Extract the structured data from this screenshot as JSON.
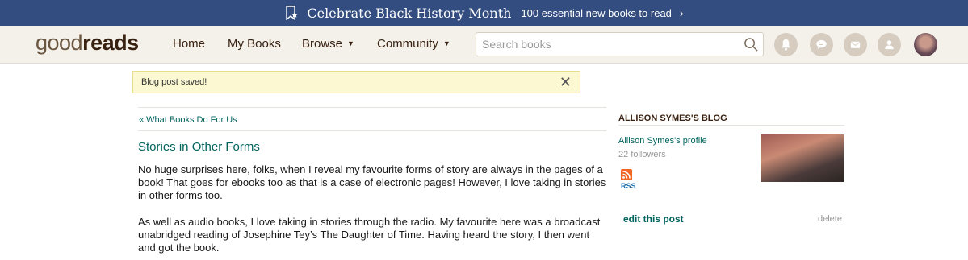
{
  "banner": {
    "title": "Celebrate Black History Month",
    "subtitle": "100 essential new books to read",
    "chevron": "›",
    "icon": "bookmark-star-icon"
  },
  "nav": {
    "logo_light": "good",
    "logo_bold": "reads",
    "home": "Home",
    "my_books": "My Books",
    "browse": "Browse",
    "community": "Community",
    "caret": "▼",
    "search_placeholder": "Search books",
    "icons": [
      "notifications-icon",
      "discussions-icon",
      "messages-icon",
      "friends-icon",
      "profile-avatar"
    ]
  },
  "flash": {
    "message": "Blog post saved!",
    "close": "✕"
  },
  "post": {
    "back_link": "« What Books Do For Us",
    "title": "Stories in Other Forms",
    "para1": "No huge surprises here, folks, when I reveal my favourite forms of story are always in the pages of a book! That goes for ebooks too as that is a case of electronic pages! However, I love taking in stories in other forms too.",
    "para2": "As well as audio books, I love taking in stories through the radio. My favourite here was a broadcast unabridged reading of Josephine Tey’s The Daughter of Time. Having heard the story, I then went and got the book."
  },
  "sidebar": {
    "heading": "ALLISON SYMES'S BLOG",
    "profile_link": "Allison Symes's profile",
    "followers": "22 followers",
    "rss_label": "RSS",
    "edit_post": "edit this post",
    "delete": "delete"
  },
  "colors": {
    "banner_bg": "#334d80",
    "nav_bg": "#f4f1ea",
    "link_teal": "#00635d",
    "brown": "#382110",
    "flash_bg": "#fcf8d2"
  }
}
